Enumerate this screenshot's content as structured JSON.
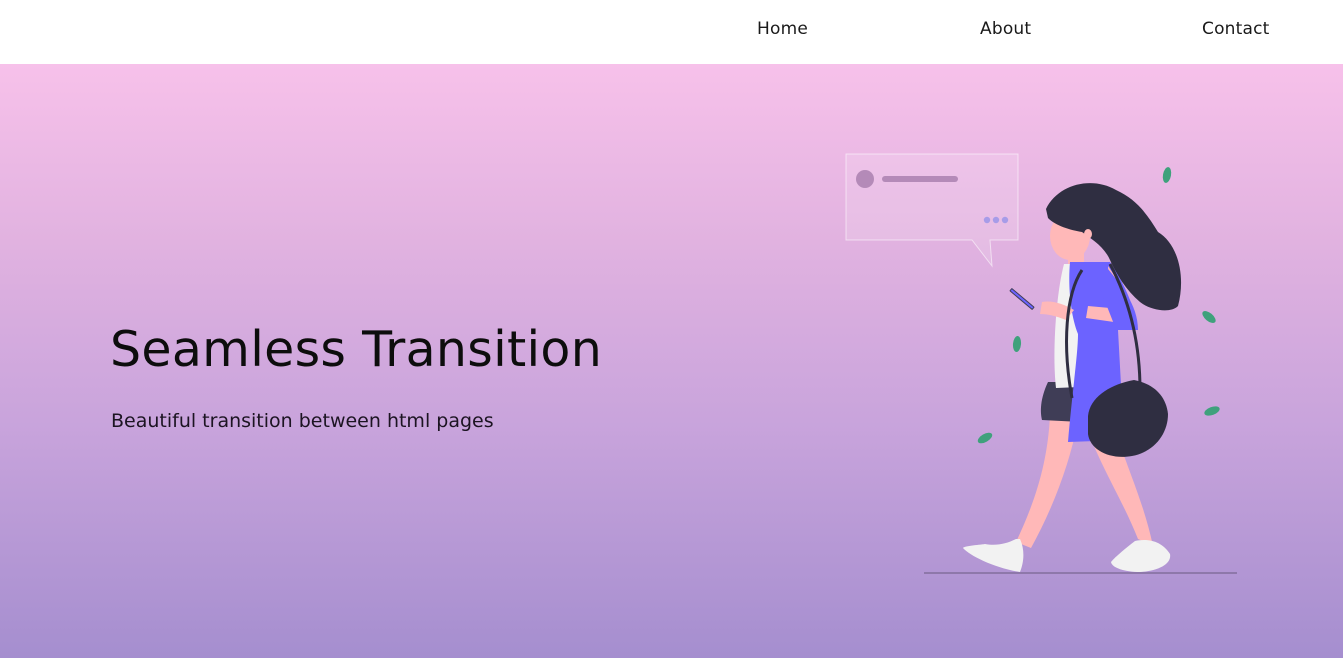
{
  "nav": {
    "home": "Home",
    "about": "About",
    "contact": "Contact"
  },
  "hero": {
    "title": "Seamless Transition",
    "subtitle": "Beautiful transition between html pages"
  },
  "illustration": {
    "subject": "woman-walking-with-phone-illustration",
    "colors": {
      "accent": "#6c63ff",
      "hair": "#2f2e41",
      "skin": "#ffb8b8",
      "leaf": "#3fa17c"
    }
  }
}
